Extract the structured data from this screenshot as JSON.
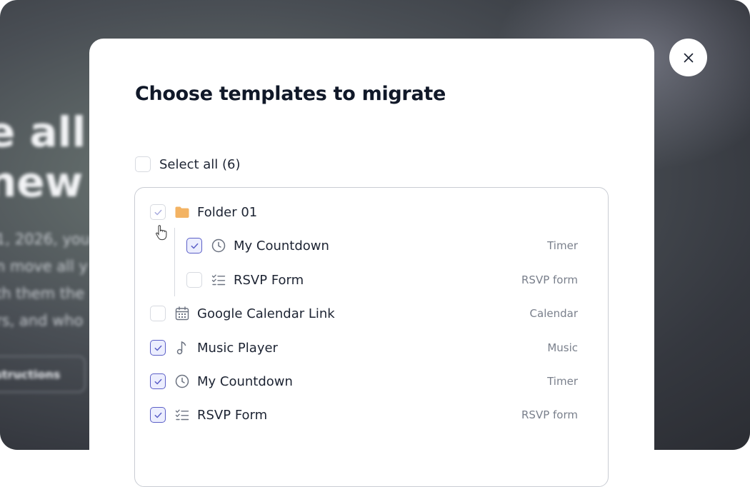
{
  "background": {
    "heading_line1": "e all",
    "heading_line2": "new",
    "text_lines": [
      "1, 2026, you",
      "n move all y",
      "th them the",
      "rs, and who"
    ],
    "button_label": "nstructions"
  },
  "modal": {
    "title": "Choose templates to migrate",
    "select_all_label": "Select all (6)",
    "close_icon": "close-icon",
    "accent_color": "#5b5fc7",
    "folder_color": "#f3b363"
  },
  "items": [
    {
      "name": "Folder 01",
      "type": "",
      "icon": "folder-icon",
      "checked": true,
      "indeterminate": true
    },
    {
      "name": "My Countdown",
      "type": "Timer",
      "icon": "clock-icon",
      "checked": true
    },
    {
      "name": "RSVP Form",
      "type": "RSVP form",
      "icon": "checklist-icon",
      "checked": false
    },
    {
      "name": "Google Calendar Link",
      "type": "Calendar",
      "icon": "calendar-icon",
      "checked": false
    },
    {
      "name": "Music Player",
      "type": "Music",
      "icon": "music-note-icon",
      "checked": true
    },
    {
      "name": "My Countdown",
      "type": "Timer",
      "icon": "clock-icon",
      "checked": true
    },
    {
      "name": "RSVP Form",
      "type": "RSVP form",
      "icon": "checklist-icon",
      "checked": true
    }
  ]
}
